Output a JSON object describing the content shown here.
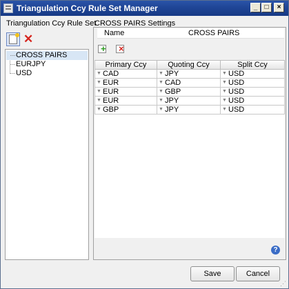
{
  "window": {
    "title": "Triangulation Ccy Rule Set Manager"
  },
  "left_panel": {
    "label": "Triangulation Ccy Rule Set",
    "tree_items": [
      {
        "label": "CROSS PAIRS",
        "selected": true
      },
      {
        "label": "EURJPY",
        "selected": false
      },
      {
        "label": "USD",
        "selected": false
      }
    ]
  },
  "right_panel": {
    "label": "CROSS PAIRS Settings",
    "name_label": "Name",
    "name_value": "CROSS PAIRS",
    "grid": {
      "columns": [
        "Primary Ccy",
        "Quoting Ccy",
        "Split Ccy"
      ],
      "rows": [
        [
          "CAD",
          "JPY",
          "USD"
        ],
        [
          "EUR",
          "CAD",
          "USD"
        ],
        [
          "EUR",
          "GBP",
          "USD"
        ],
        [
          "EUR",
          "JPY",
          "USD"
        ],
        [
          "GBP",
          "JPY",
          "USD"
        ]
      ]
    }
  },
  "footer": {
    "save_label": "Save",
    "cancel_label": "Cancel"
  },
  "icons": {
    "app": "window-icon",
    "new": "new-ruleset-icon",
    "delete": "delete-icon",
    "add_row": "add-row-icon",
    "remove_row": "remove-row-icon",
    "help": "help-icon"
  },
  "colors": {
    "titlebar": "#1f4596",
    "selection": "#d8e6f5",
    "delete_red": "#d6251e",
    "add_green": "#2a9a1e"
  }
}
